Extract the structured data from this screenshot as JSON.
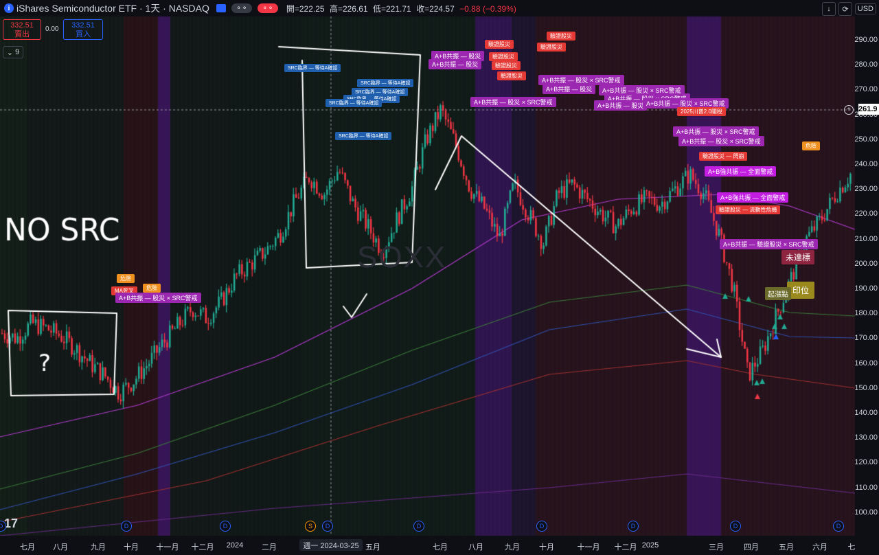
{
  "header": {
    "symbol": "iShares Semiconductor ETF · 1天 · NASDAQ",
    "open_label": "開=222.25",
    "high_label": "高=226.61",
    "low_label": "低=221.71",
    "close_label": "收=224.57",
    "change": "−0.88 (−0.39%)",
    "currency": "USD"
  },
  "trade": {
    "sell_price": "332.51",
    "sell_label": "賣出",
    "spread": "0.00",
    "buy_price": "332.51",
    "buy_label": "買入"
  },
  "indicator_count": "9",
  "current_price": "261.9",
  "watermark": "SOXX",
  "y_ticks": [
    "290.00",
    "280.00",
    "270.00",
    "260.00",
    "250.00",
    "240.00",
    "230.00",
    "220.00",
    "210.00",
    "200.00",
    "190.00",
    "180.00",
    "170.00",
    "160.00",
    "150.00",
    "140.00",
    "130.00",
    "120.00",
    "110.00",
    "100.00"
  ],
  "x_ticks": [
    "七月",
    "八月",
    "九月",
    "十月",
    "十一月",
    "十二月",
    "2024",
    "二月",
    "五月",
    "七月",
    "八月",
    "九月",
    "十月",
    "十一月",
    "十二月",
    "2025",
    "三月",
    "四月",
    "五月",
    "六月",
    "七"
  ],
  "x_selected": "週一 2024-03-25",
  "dividend_mark": "D",
  "split_mark": "S",
  "annotations": {
    "purple_sell": "A+B共振 — 股災 × SRC警戒",
    "purple_sell_short": "A+B共振 — 股災",
    "strong": "A+B強共振 — 全面警戒",
    "strong_liq": "A+B共振 — 驗證股災 × SRC警戒",
    "src_wait": "SRC臨界 — 等待A確認",
    "verify_crash": "驗證股災",
    "verify_flash": "驗證股災 — 閃崩",
    "verify_liquidity": "驗證股災 — 流動性危機",
    "danger": "危險",
    "trump": "2025川普2.0關稅",
    "not_reached": "未達標",
    "rise": "起漲點",
    "mark_pos": "印位",
    "ma_hint": "MA死叉"
  },
  "handwriting": {
    "no_src": "NO SRC",
    "question": "?"
  },
  "chart_data": {
    "type": "candlestick",
    "title": "iShares Semiconductor ETF · 1天 · NASDAQ",
    "ylim": [
      95,
      295
    ],
    "last_price": 261.9,
    "close_series": [
      172,
      170,
      176,
      174,
      171,
      166,
      160,
      155,
      148,
      153,
      160,
      168,
      175,
      182,
      178,
      185,
      195,
      200,
      205,
      212,
      225,
      235,
      228,
      238,
      224,
      215,
      205,
      218,
      230,
      250,
      262,
      248,
      230,
      222,
      210,
      232,
      220,
      208,
      228,
      232,
      226,
      220,
      215,
      222,
      226,
      224,
      230,
      236,
      228,
      212,
      190,
      155,
      165,
      180,
      195,
      210,
      218,
      228,
      236
    ]
  }
}
